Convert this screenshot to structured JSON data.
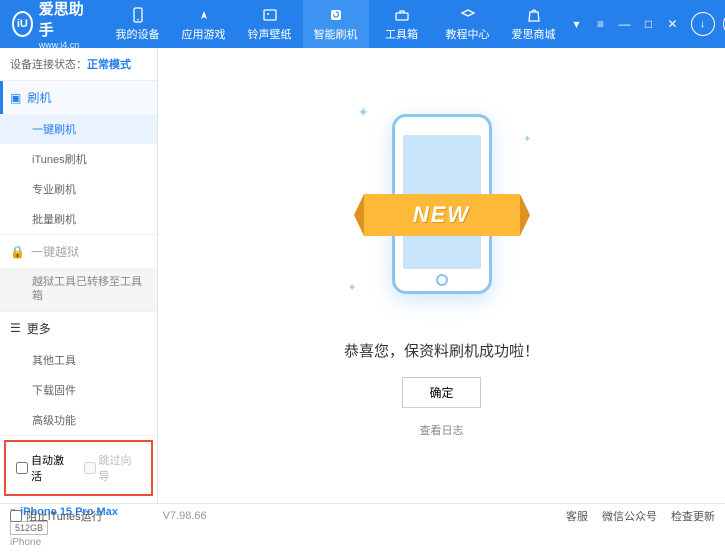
{
  "app": {
    "name": "爱思助手",
    "url": "www.i4.cn",
    "logo_letter": "iU"
  },
  "nav": [
    {
      "label": "我的设备"
    },
    {
      "label": "应用游戏"
    },
    {
      "label": "铃声壁纸"
    },
    {
      "label": "智能刷机",
      "active": true
    },
    {
      "label": "工具箱"
    },
    {
      "label": "教程中心"
    },
    {
      "label": "爱思商城"
    }
  ],
  "status": {
    "label": "设备连接状态：",
    "value": "正常模式"
  },
  "sidebar": {
    "flash": {
      "title": "刷机",
      "items": [
        "一键刷机",
        "iTunes刷机",
        "专业刷机",
        "批量刷机"
      ]
    },
    "jailbreak": {
      "title": "一键越狱",
      "note": "越狱工具已转移至工具箱"
    },
    "more": {
      "title": "更多",
      "items": [
        "其他工具",
        "下载固件",
        "高级功能"
      ]
    }
  },
  "checkboxes": {
    "auto_activate": "自动激活",
    "skip_guide": "跳过向导"
  },
  "device": {
    "name": "iPhone 15 Pro Max",
    "storage": "512GB",
    "type": "iPhone"
  },
  "main": {
    "banner": "NEW",
    "message": "恭喜您，保资料刷机成功啦！",
    "ok": "确定",
    "log": "查看日志"
  },
  "footer": {
    "block_itunes": "阻止iTunes运行",
    "version": "V7.98.66",
    "links": [
      "客服",
      "微信公众号",
      "检查更新"
    ]
  }
}
